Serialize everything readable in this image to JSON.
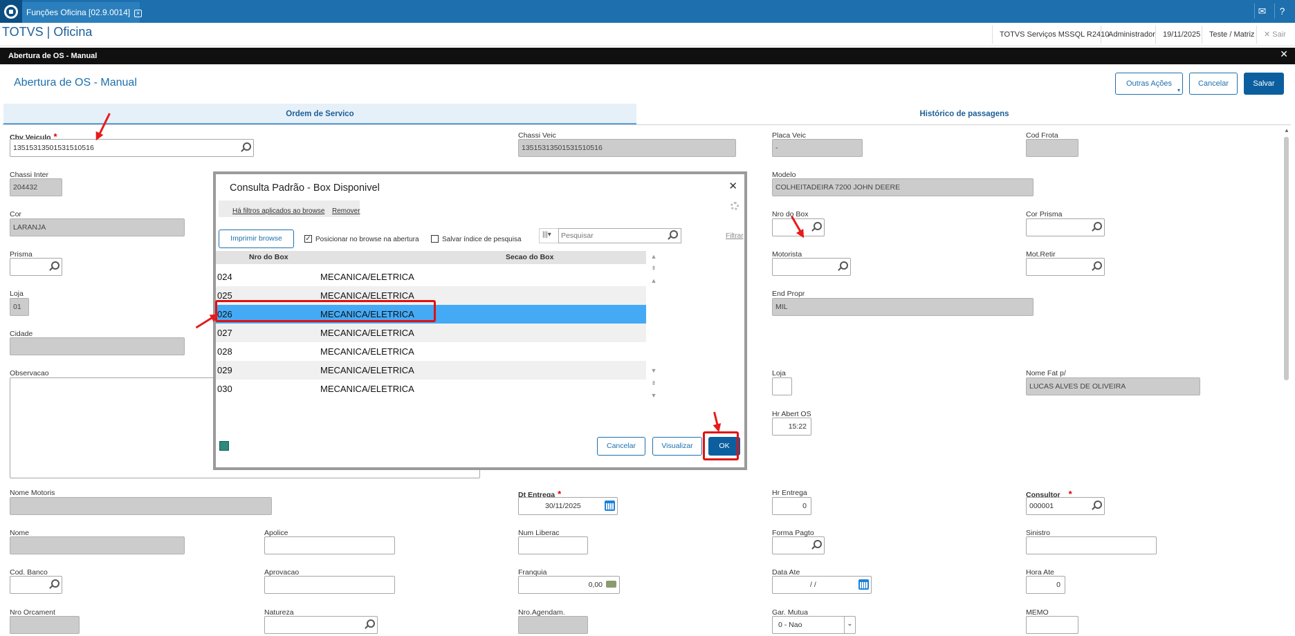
{
  "topbar": {
    "tab_title": "Funções Oficina [02.9.0014]",
    "icons": [
      "totvs-logo-icon",
      "mail-icon",
      "help-icon"
    ]
  },
  "header": {
    "brand": "TOTVS | Oficina",
    "server": "TOTVS Serviços MSSQL R2410",
    "user": "Administrador",
    "date": "19/11/2025",
    "branch": "Teste / Matriz",
    "exit": "Sair"
  },
  "window": {
    "title": "Abertura de OS - Manual",
    "page_title": "Abertura de OS - Manual",
    "actions": {
      "more": "Outras Ações",
      "cancel": "Cancelar",
      "save": "Salvar"
    }
  },
  "tabs": [
    {
      "label": "Ordem de Servico"
    },
    {
      "label": "Histórico de passagens"
    }
  ],
  "form": {
    "chv_veiculo": {
      "label": "Chv Veiculo",
      "value": "13515313501531510516"
    },
    "chassi_veic": {
      "label": "Chassi Veic",
      "value": "13515313501531510516"
    },
    "placa_veic": {
      "label": "Placa Veic",
      "value": "-"
    },
    "cod_frota": {
      "label": "Cod Frota",
      "value": ""
    },
    "chassi_inter": {
      "label": "Chassi Inter",
      "value": "204432"
    },
    "modelo": {
      "label": "Modelo",
      "value": "COLHEITADEIRA 7200  JOHN DEERE"
    },
    "cor": {
      "label": "Cor",
      "value": "LARANJA"
    },
    "nro_box": {
      "label": "Nro do Box",
      "value": ""
    },
    "cor_prisma": {
      "label": "Cor Prisma",
      "value": ""
    },
    "prisma": {
      "label": "Prisma",
      "value": ""
    },
    "motorista": {
      "label": "Motorista",
      "value": ""
    },
    "mot_retir": {
      "label": "Mot.Retir",
      "value": ""
    },
    "loja": {
      "label": "Loja",
      "value": "01"
    },
    "end_propr": {
      "label": "End Propr",
      "value": "MIL"
    },
    "cidade": {
      "label": "Cidade",
      "value": ""
    },
    "observacao": {
      "label": "Observacao",
      "value": ""
    },
    "loja2": {
      "label": "Loja",
      "value": ""
    },
    "nome_fat": {
      "label": "Nome Fat p/",
      "value": "LUCAS ALVES DE OLIVEIRA"
    },
    "hr_abert": {
      "label": "Hr Abert OS",
      "value": "15:22"
    },
    "nome_motoris": {
      "label": "Nome Motoris",
      "value": ""
    },
    "dt_entrega": {
      "label": "Dt Entrega",
      "value": "30/11/2025"
    },
    "hr_entrega": {
      "label": "Hr Entrega",
      "value": "0"
    },
    "consultor": {
      "label": "Consultor",
      "value": "000001"
    },
    "nome": {
      "label": "Nome",
      "value": ""
    },
    "apolice": {
      "label": "Apolice",
      "value": ""
    },
    "num_liberac": {
      "label": "Num Liberac",
      "value": ""
    },
    "forma_pagto": {
      "label": "Forma Pagto",
      "value": ""
    },
    "sinistro": {
      "label": "Sinistro",
      "value": ""
    },
    "cod_banco": {
      "label": "Cod. Banco",
      "value": ""
    },
    "aprovacao": {
      "label": "Aprovacao",
      "value": ""
    },
    "franquia": {
      "label": "Franquia",
      "value": "0,00"
    },
    "data_ate": {
      "label": "Data Ate",
      "value": "/  /"
    },
    "hora_ate": {
      "label": "Hora Ate",
      "value": "0"
    },
    "nro_orcament": {
      "label": "Nro Orcament",
      "value": ""
    },
    "natureza": {
      "label": "Natureza",
      "value": ""
    },
    "nro_agendam": {
      "label": "Nro.Agendam.",
      "value": ""
    },
    "gar_mutua": {
      "label": "Gar. Mutua",
      "value": "0 - Nao"
    },
    "memo": {
      "label": "MEMO",
      "value": ""
    }
  },
  "modal": {
    "title": "Consulta Padrão - Box Disponivel",
    "filters_applied": "Há filtros aplicados ao browse",
    "remove": "Remover",
    "print_browse": "Imprimir browse",
    "position_label": "Posicionar no browse na abertura",
    "position_checked": true,
    "save_index_label": "Salvar índice de pesquisa",
    "save_index_checked": false,
    "search_placeholder": "Pesquisar",
    "filter": "Filtrar",
    "columns": [
      "Nro do Box",
      "Secao do Box"
    ],
    "rows": [
      {
        "nro": "024",
        "secao": "MECANICA/ELETRICA"
      },
      {
        "nro": "025",
        "secao": "MECANICA/ELETRICA"
      },
      {
        "nro": "026",
        "secao": "MECANICA/ELETRICA"
      },
      {
        "nro": "027",
        "secao": "MECANICA/ELETRICA"
      },
      {
        "nro": "028",
        "secao": "MECANICA/ELETRICA"
      },
      {
        "nro": "029",
        "secao": "MECANICA/ELETRICA"
      },
      {
        "nro": "030",
        "secao": "MECANICA/ELETRICA"
      }
    ],
    "selected_row": "026",
    "buttons": {
      "cancel": "Cancelar",
      "view": "Visualizar",
      "ok": "OK"
    }
  },
  "colors": {
    "brand_blue": "#1d6fad",
    "selected_row": "#44aaf5",
    "annotation_red": "#e61b1b"
  }
}
